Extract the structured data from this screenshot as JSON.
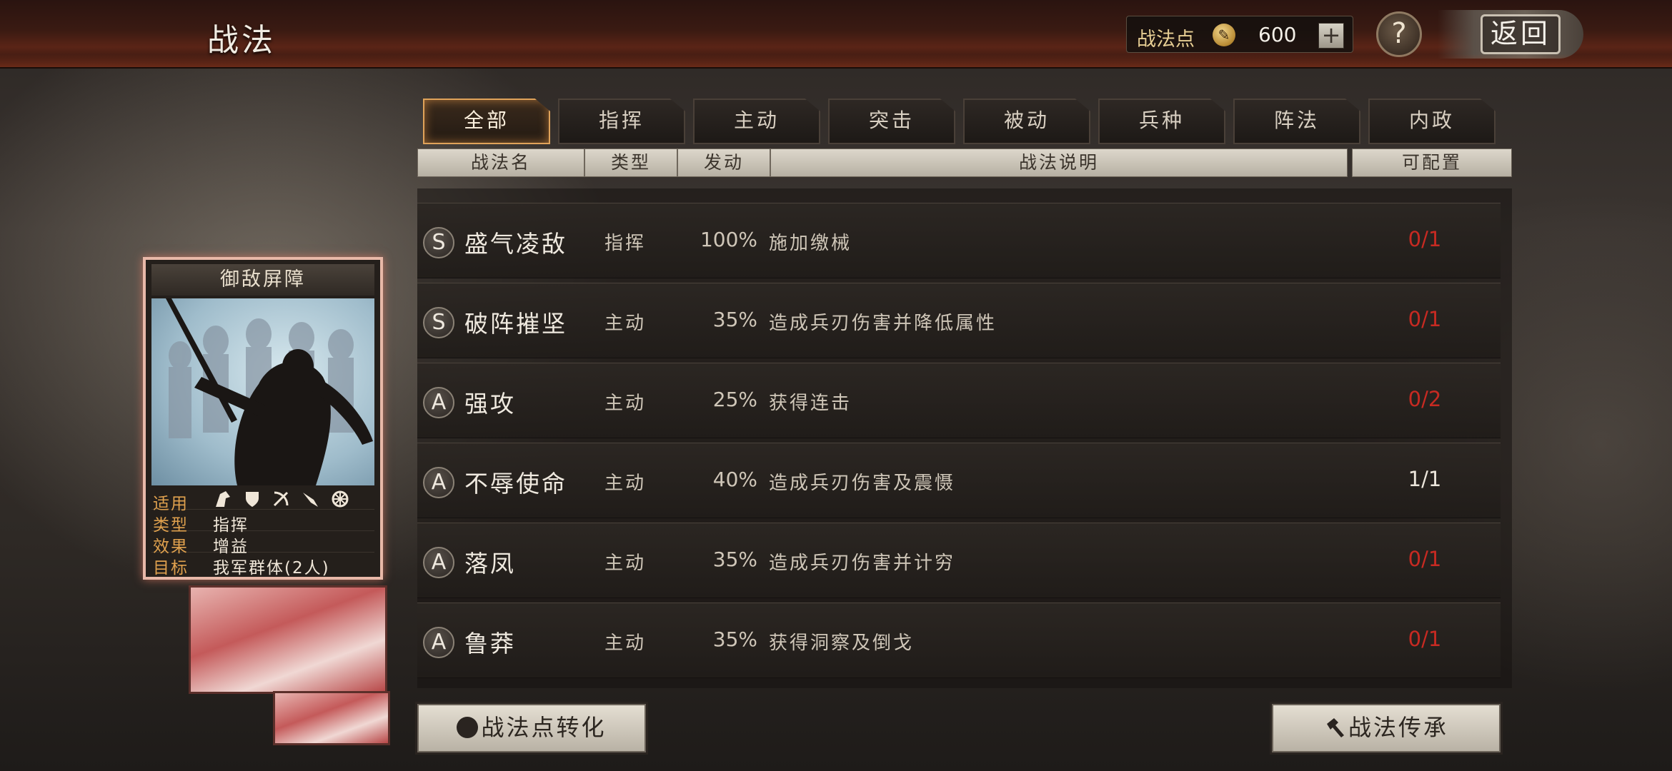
{
  "header": {
    "title": "战法",
    "points_label": "战法点",
    "points_value": "600",
    "plus_label": "+",
    "help_label": "?",
    "back_label": "返回"
  },
  "tabs": [
    {
      "label": "全部",
      "active": true
    },
    {
      "label": "指挥",
      "active": false
    },
    {
      "label": "主动",
      "active": false
    },
    {
      "label": "突击",
      "active": false
    },
    {
      "label": "被动",
      "active": false
    },
    {
      "label": "兵种",
      "active": false
    },
    {
      "label": "阵法",
      "active": false
    },
    {
      "label": "内政",
      "active": false
    }
  ],
  "columns": {
    "name": "战法名",
    "type": "类型",
    "rate": "发动",
    "desc": "战法说明",
    "config": "可配置"
  },
  "skills": [
    {
      "grade": "S",
      "name": "盛气凌敌",
      "type": "指挥",
      "rate": "100%",
      "desc": "施加缴械",
      "config": "0/1",
      "config_color": "red"
    },
    {
      "grade": "S",
      "name": "破阵摧坚",
      "type": "主动",
      "rate": "35%",
      "desc": "造成兵刃伤害并降低属性",
      "config": "0/1",
      "config_color": "red"
    },
    {
      "grade": "A",
      "name": "强攻",
      "type": "主动",
      "rate": "25%",
      "desc": "获得连击",
      "config": "0/2",
      "config_color": "red"
    },
    {
      "grade": "A",
      "name": "不辱使命",
      "type": "主动",
      "rate": "40%",
      "desc": "造成兵刃伤害及震慑",
      "config": "1/1",
      "config_color": "white"
    },
    {
      "grade": "A",
      "name": "落凤",
      "type": "主动",
      "rate": "35%",
      "desc": "造成兵刃伤害并计穷",
      "config": "0/1",
      "config_color": "red"
    },
    {
      "grade": "A",
      "name": "鲁莽",
      "type": "主动",
      "rate": "35%",
      "desc": "获得洞察及倒戈",
      "config": "0/1",
      "config_color": "red"
    }
  ],
  "card": {
    "title": "御敌屏障",
    "applicable_label": "适用",
    "unit_icons": [
      "cavalry-icon",
      "shield-icon",
      "archer-icon",
      "spear-icon",
      "siege-icon"
    ],
    "type_label": "类型",
    "type_value": "指挥",
    "effect_label": "效果",
    "effect_value": "增益",
    "target_label": "目标",
    "target_value": "我军群体(2人)"
  },
  "buttons": {
    "convert": "战法点转化",
    "inherit": "战法传承"
  },
  "colors": {
    "config_red": "#c72a22",
    "tab_active_border": "#e0a35a",
    "card_key": "#e0a14e"
  }
}
